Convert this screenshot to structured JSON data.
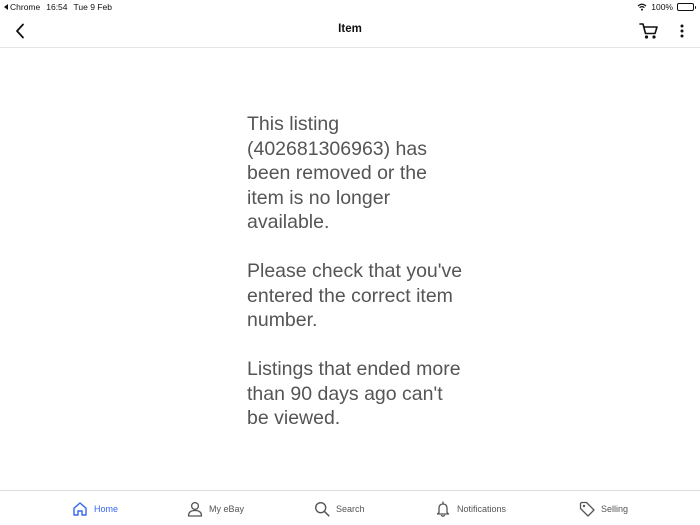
{
  "status_bar": {
    "back_app": "Chrome",
    "time": "16:54",
    "date": "Tue 9 Feb",
    "battery": "100%"
  },
  "nav": {
    "title": "Item",
    "back_icon": "chevron-left-icon",
    "cart_icon": "cart-icon",
    "more_icon": "more-vertical-icon"
  },
  "message": {
    "paragraphs": [
      "This listing (402681306963) has been removed or the item is no longer available.",
      "Please check that you've entered the correct item number.",
      "Listings that ended more than 90 days ago can't be viewed."
    ]
  },
  "tabs": [
    {
      "label": "Home",
      "icon": "home-icon",
      "active": true
    },
    {
      "label": "My eBay",
      "icon": "user-icon",
      "active": false
    },
    {
      "label": "Search",
      "icon": "search-icon",
      "active": false
    },
    {
      "label": "Notifications",
      "icon": "bell-icon",
      "active": false
    },
    {
      "label": "Selling",
      "icon": "tag-icon",
      "active": false
    }
  ],
  "colors": {
    "accent": "#3665f3",
    "body_text": "#555555"
  }
}
